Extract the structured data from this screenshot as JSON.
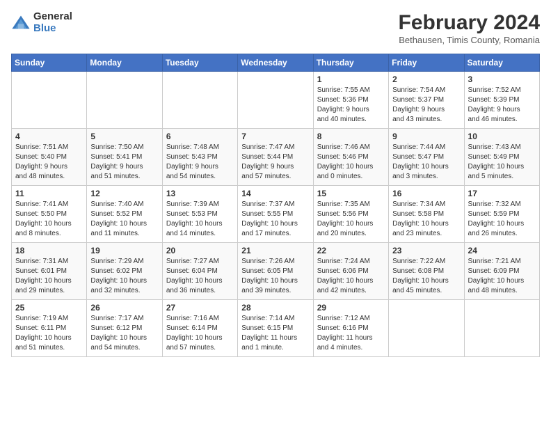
{
  "logo": {
    "general": "General",
    "blue": "Blue"
  },
  "header": {
    "title": "February 2024",
    "subtitle": "Bethausen, Timis County, Romania"
  },
  "days_of_week": [
    "Sunday",
    "Monday",
    "Tuesday",
    "Wednesday",
    "Thursday",
    "Friday",
    "Saturday"
  ],
  "weeks": [
    [
      {
        "day": "",
        "info": ""
      },
      {
        "day": "",
        "info": ""
      },
      {
        "day": "",
        "info": ""
      },
      {
        "day": "",
        "info": ""
      },
      {
        "day": "1",
        "info": "Sunrise: 7:55 AM\nSunset: 5:36 PM\nDaylight: 9 hours\nand 40 minutes."
      },
      {
        "day": "2",
        "info": "Sunrise: 7:54 AM\nSunset: 5:37 PM\nDaylight: 9 hours\nand 43 minutes."
      },
      {
        "day": "3",
        "info": "Sunrise: 7:52 AM\nSunset: 5:39 PM\nDaylight: 9 hours\nand 46 minutes."
      }
    ],
    [
      {
        "day": "4",
        "info": "Sunrise: 7:51 AM\nSunset: 5:40 PM\nDaylight: 9 hours\nand 48 minutes."
      },
      {
        "day": "5",
        "info": "Sunrise: 7:50 AM\nSunset: 5:41 PM\nDaylight: 9 hours\nand 51 minutes."
      },
      {
        "day": "6",
        "info": "Sunrise: 7:48 AM\nSunset: 5:43 PM\nDaylight: 9 hours\nand 54 minutes."
      },
      {
        "day": "7",
        "info": "Sunrise: 7:47 AM\nSunset: 5:44 PM\nDaylight: 9 hours\nand 57 minutes."
      },
      {
        "day": "8",
        "info": "Sunrise: 7:46 AM\nSunset: 5:46 PM\nDaylight: 10 hours\nand 0 minutes."
      },
      {
        "day": "9",
        "info": "Sunrise: 7:44 AM\nSunset: 5:47 PM\nDaylight: 10 hours\nand 3 minutes."
      },
      {
        "day": "10",
        "info": "Sunrise: 7:43 AM\nSunset: 5:49 PM\nDaylight: 10 hours\nand 5 minutes."
      }
    ],
    [
      {
        "day": "11",
        "info": "Sunrise: 7:41 AM\nSunset: 5:50 PM\nDaylight: 10 hours\nand 8 minutes."
      },
      {
        "day": "12",
        "info": "Sunrise: 7:40 AM\nSunset: 5:52 PM\nDaylight: 10 hours\nand 11 minutes."
      },
      {
        "day": "13",
        "info": "Sunrise: 7:39 AM\nSunset: 5:53 PM\nDaylight: 10 hours\nand 14 minutes."
      },
      {
        "day": "14",
        "info": "Sunrise: 7:37 AM\nSunset: 5:55 PM\nDaylight: 10 hours\nand 17 minutes."
      },
      {
        "day": "15",
        "info": "Sunrise: 7:35 AM\nSunset: 5:56 PM\nDaylight: 10 hours\nand 20 minutes."
      },
      {
        "day": "16",
        "info": "Sunrise: 7:34 AM\nSunset: 5:58 PM\nDaylight: 10 hours\nand 23 minutes."
      },
      {
        "day": "17",
        "info": "Sunrise: 7:32 AM\nSunset: 5:59 PM\nDaylight: 10 hours\nand 26 minutes."
      }
    ],
    [
      {
        "day": "18",
        "info": "Sunrise: 7:31 AM\nSunset: 6:01 PM\nDaylight: 10 hours\nand 29 minutes."
      },
      {
        "day": "19",
        "info": "Sunrise: 7:29 AM\nSunset: 6:02 PM\nDaylight: 10 hours\nand 32 minutes."
      },
      {
        "day": "20",
        "info": "Sunrise: 7:27 AM\nSunset: 6:04 PM\nDaylight: 10 hours\nand 36 minutes."
      },
      {
        "day": "21",
        "info": "Sunrise: 7:26 AM\nSunset: 6:05 PM\nDaylight: 10 hours\nand 39 minutes."
      },
      {
        "day": "22",
        "info": "Sunrise: 7:24 AM\nSunset: 6:06 PM\nDaylight: 10 hours\nand 42 minutes."
      },
      {
        "day": "23",
        "info": "Sunrise: 7:22 AM\nSunset: 6:08 PM\nDaylight: 10 hours\nand 45 minutes."
      },
      {
        "day": "24",
        "info": "Sunrise: 7:21 AM\nSunset: 6:09 PM\nDaylight: 10 hours\nand 48 minutes."
      }
    ],
    [
      {
        "day": "25",
        "info": "Sunrise: 7:19 AM\nSunset: 6:11 PM\nDaylight: 10 hours\nand 51 minutes."
      },
      {
        "day": "26",
        "info": "Sunrise: 7:17 AM\nSunset: 6:12 PM\nDaylight: 10 hours\nand 54 minutes."
      },
      {
        "day": "27",
        "info": "Sunrise: 7:16 AM\nSunset: 6:14 PM\nDaylight: 10 hours\nand 57 minutes."
      },
      {
        "day": "28",
        "info": "Sunrise: 7:14 AM\nSunset: 6:15 PM\nDaylight: 11 hours\nand 1 minute."
      },
      {
        "day": "29",
        "info": "Sunrise: 7:12 AM\nSunset: 6:16 PM\nDaylight: 11 hours\nand 4 minutes."
      },
      {
        "day": "",
        "info": ""
      },
      {
        "day": "",
        "info": ""
      }
    ]
  ]
}
